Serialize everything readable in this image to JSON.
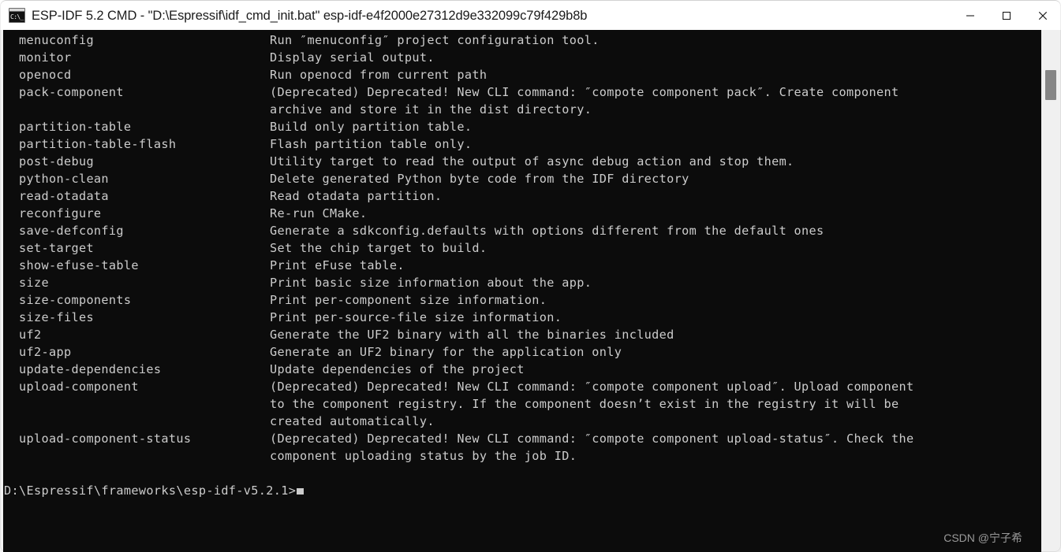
{
  "window": {
    "title": "ESP-IDF 5.2 CMD - \"D:\\Espressif\\idf_cmd_init.bat\"  esp-idf-e4f2000e27312d9e332099c79f429b8b",
    "icon_label": "C:\\_",
    "controls": {
      "minimize": "Minimize",
      "maximize": "Maximize",
      "close": "Close"
    }
  },
  "terminal": {
    "background_color": "#0c0c0c",
    "foreground_color": "#cccccc",
    "rows": [
      {
        "name": "menuconfig",
        "desc": "Run ″menuconfig″ project configuration tool."
      },
      {
        "name": "monitor",
        "desc": "Display serial output."
      },
      {
        "name": "openocd",
        "desc": "Run openocd from current path"
      },
      {
        "name": "pack-component",
        "desc": "(Deprecated) Deprecated! New CLI command: ″compote component pack″. Create component",
        "cont": [
          "archive and store it in the dist directory."
        ]
      },
      {
        "name": "partition-table",
        "desc": "Build only partition table."
      },
      {
        "name": "partition-table-flash",
        "desc": "Flash partition table only."
      },
      {
        "name": "post-debug",
        "desc": "Utility target to read the output of async debug action and stop them."
      },
      {
        "name": "python-clean",
        "desc": "Delete generated Python byte code from the IDF directory"
      },
      {
        "name": "read-otadata",
        "desc": "Read otadata partition."
      },
      {
        "name": "reconfigure",
        "desc": "Re-run CMake."
      },
      {
        "name": "save-defconfig",
        "desc": "Generate a sdkconfig.defaults with options different from the default ones"
      },
      {
        "name": "set-target",
        "desc": "Set the chip target to build."
      },
      {
        "name": "show-efuse-table",
        "desc": "Print eFuse table."
      },
      {
        "name": "size",
        "desc": "Print basic size information about the app."
      },
      {
        "name": "size-components",
        "desc": "Print per-component size information."
      },
      {
        "name": "size-files",
        "desc": "Print per-source-file size information."
      },
      {
        "name": "uf2",
        "desc": "Generate the UF2 binary with all the binaries included"
      },
      {
        "name": "uf2-app",
        "desc": "Generate an UF2 binary for the application only"
      },
      {
        "name": "update-dependencies",
        "desc": "Update dependencies of the project"
      },
      {
        "name": "upload-component",
        "desc": "(Deprecated) Deprecated! New CLI command: ″compote component upload″. Upload component",
        "cont": [
          "to the component registry. If the component doesn’t exist in the registry it will be",
          "created automatically."
        ]
      },
      {
        "name": "upload-component-status",
        "desc": "(Deprecated) Deprecated! New CLI command: ″compote component upload-status″. Check the",
        "cont": [
          "component uploading status by the job ID."
        ]
      }
    ],
    "prompt": "D:\\Espressif\\frameworks\\esp-idf-v5.2.1>",
    "cursor": "block"
  },
  "scrollbar": {
    "orientation": "vertical",
    "thumb_position_percent": 4,
    "track_color": "#f0f0f0",
    "thumb_color": "#868686"
  },
  "watermark": {
    "text": "CSDN @宁子希"
  }
}
